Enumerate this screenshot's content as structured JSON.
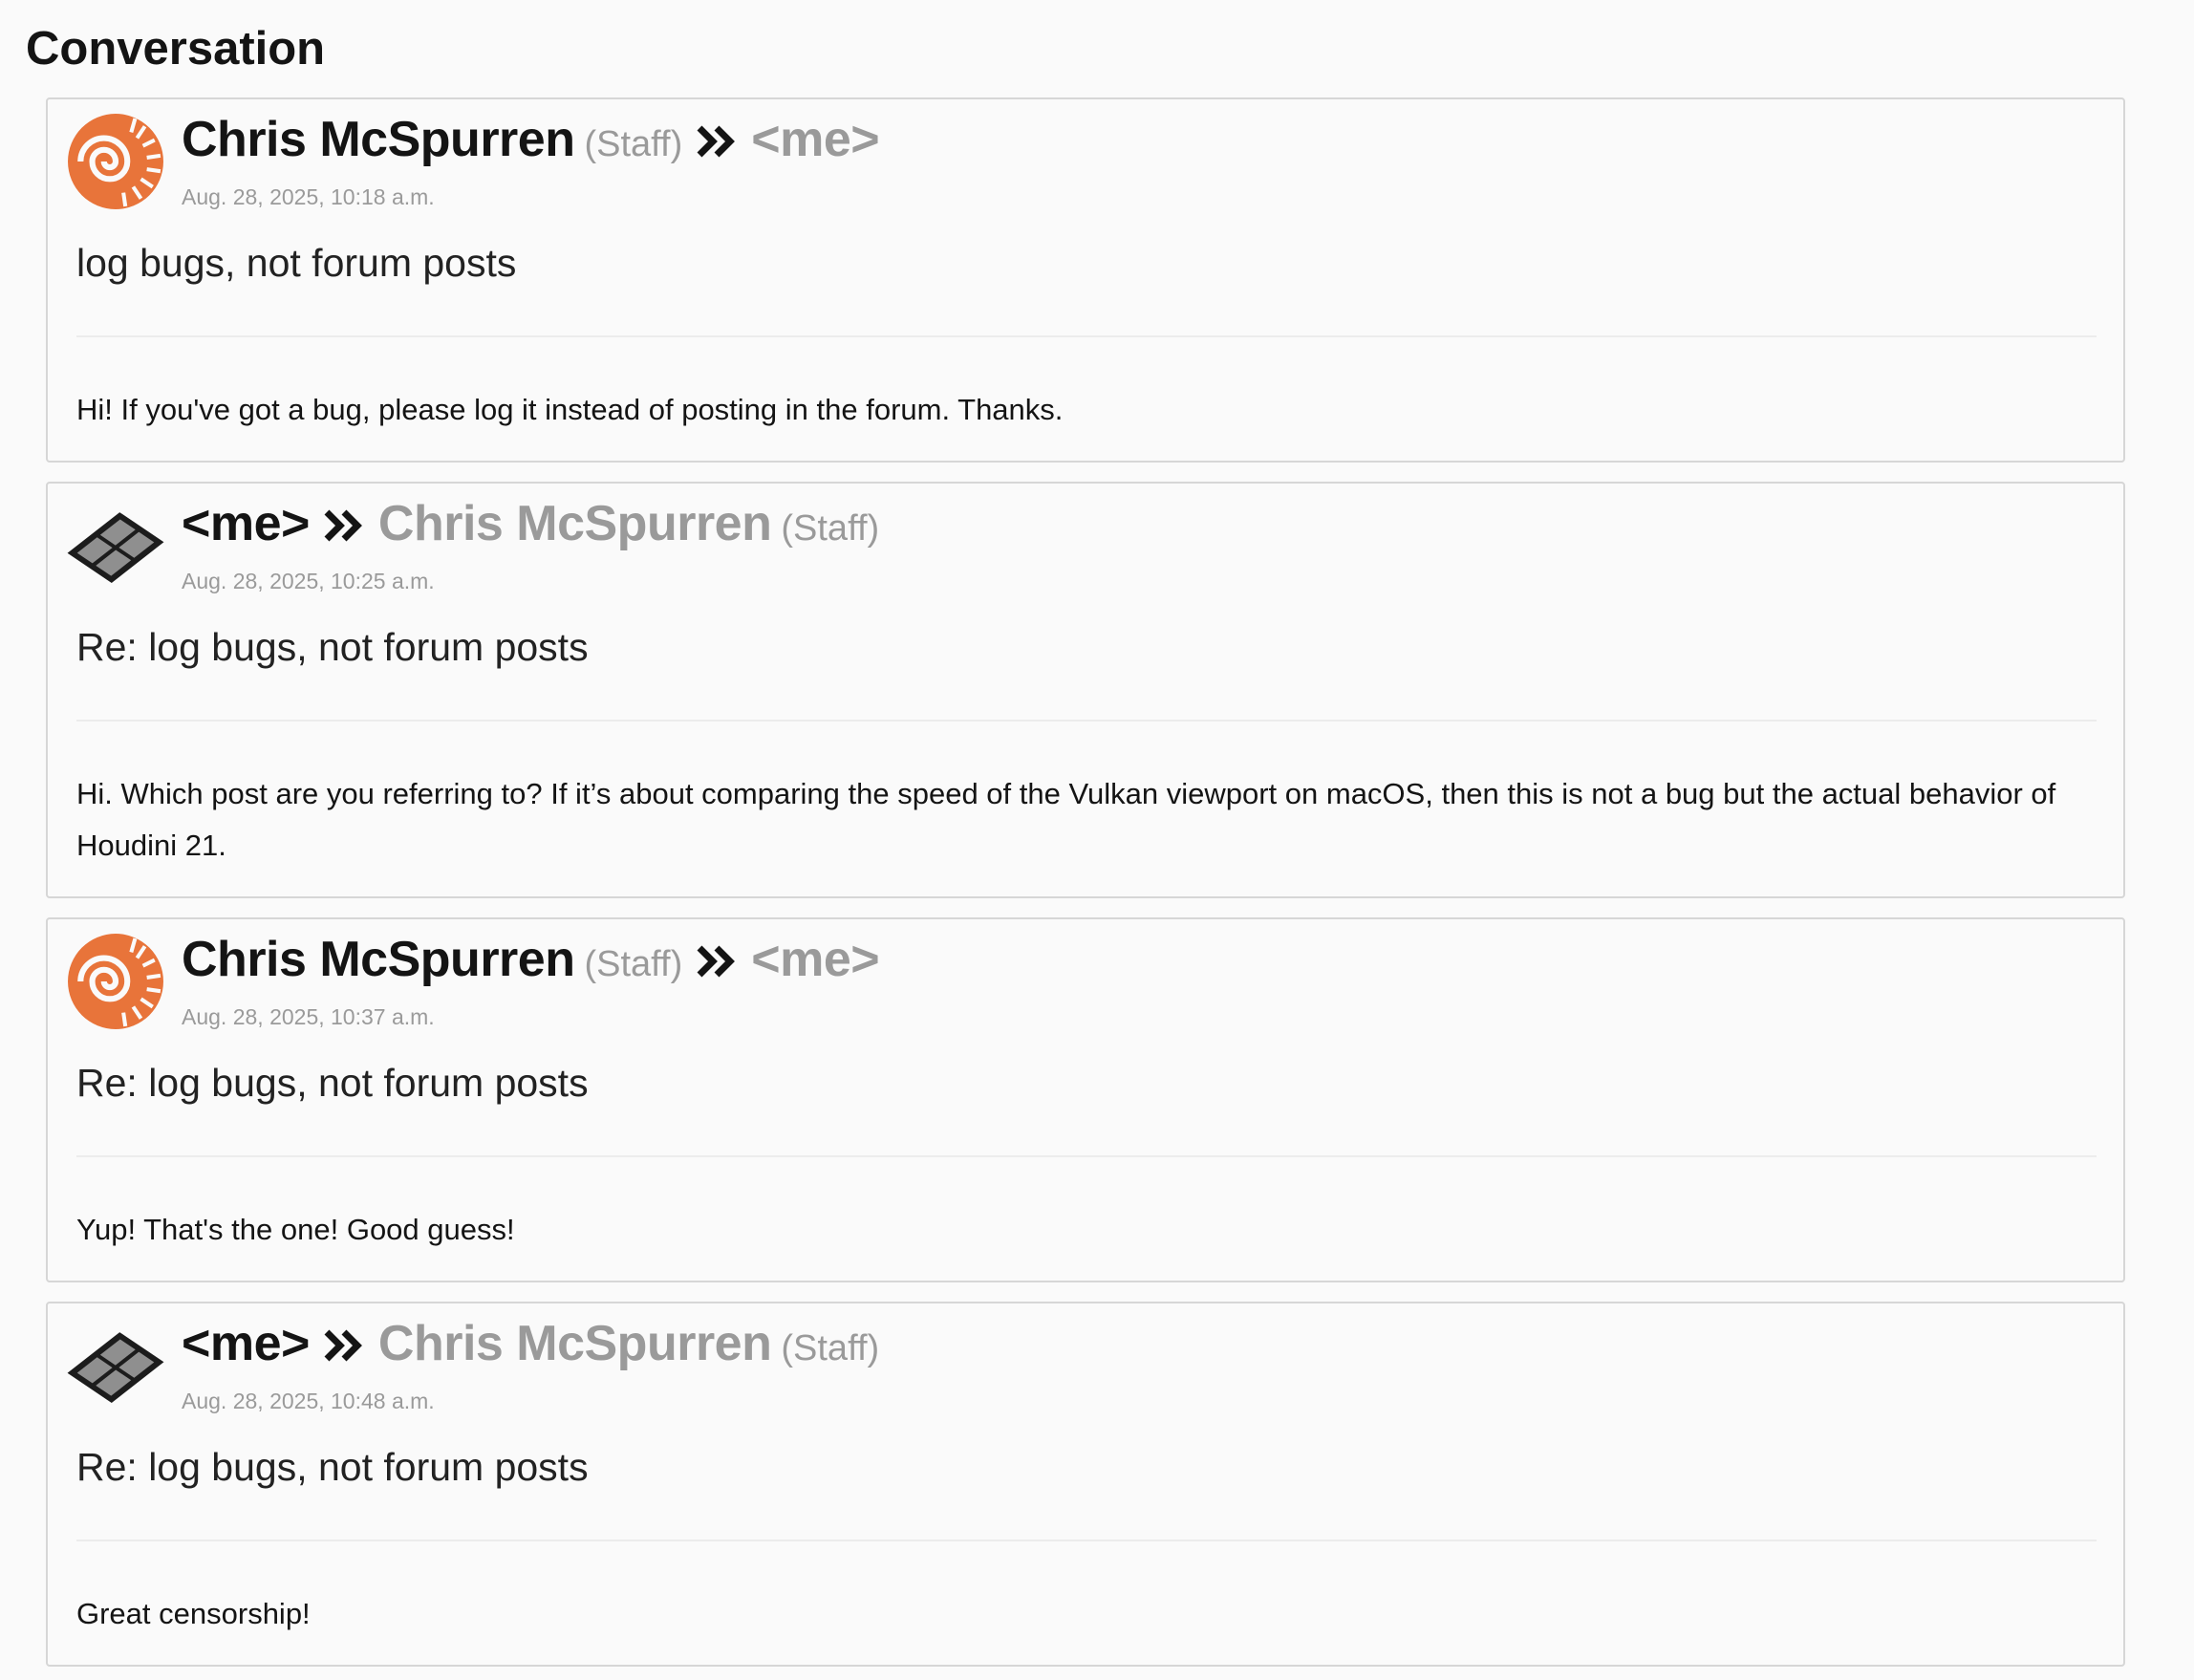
{
  "page": {
    "title": "Conversation"
  },
  "messages": [
    {
      "sender": "Chris McSpurren",
      "sender_role": "(Staff)",
      "recipient": "<me>",
      "recipient_role": "",
      "avatar_icon": "houdini-swirl-logo",
      "date": "Aug. 28, 2025, 10:18 a.m.",
      "subject": "log bugs, not forum posts",
      "body": "Hi! If you've got a bug, please log it instead of posting in the forum. Thanks."
    },
    {
      "sender": "<me>",
      "sender_role": "",
      "recipient": "Chris McSpurren",
      "recipient_role": "(Staff)",
      "avatar_icon": "grid-window-avatar",
      "date": "Aug. 28, 2025, 10:25 a.m.",
      "subject": "Re: log bugs, not forum posts",
      "body": "Hi. Which post are you referring to? If it’s about comparing the speed of the Vulkan viewport on macOS, then this is not a bug but the actual behavior of Houdini 21."
    },
    {
      "sender": "Chris McSpurren",
      "sender_role": "(Staff)",
      "recipient": "<me>",
      "recipient_role": "",
      "avatar_icon": "houdini-swirl-logo",
      "date": "Aug. 28, 2025, 10:37 a.m.",
      "subject": "Re: log bugs, not forum posts",
      "body": "Yup! That's the one! Good guess!"
    },
    {
      "sender": "<me>",
      "sender_role": "",
      "recipient": "Chris McSpurren",
      "recipient_role": "(Staff)",
      "avatar_icon": "grid-window-avatar",
      "date": "Aug. 28, 2025, 10:48 a.m.",
      "subject": "Re: log bugs, not forum posts",
      "body": "Great censorship!"
    }
  ],
  "colors": {
    "houdini_orange": "#e8743a",
    "muted_text": "#9a9a9a",
    "border": "#d6d6d6"
  }
}
